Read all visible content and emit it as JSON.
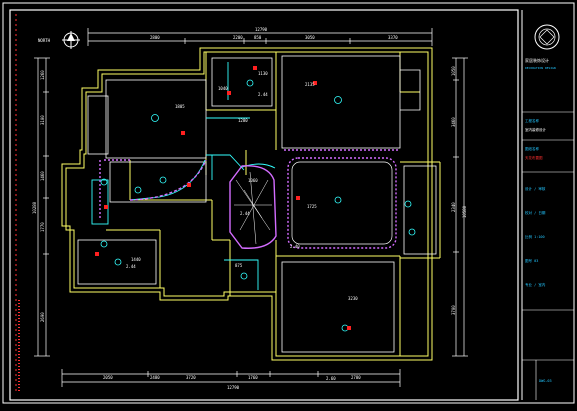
{
  "colors": {
    "background": "#000000",
    "frame": "#ffffff",
    "dimension": "#ffffff",
    "wall": "#ffff66",
    "ceiling_outline": "#ffffff",
    "cyan_line": "#33ffff",
    "magenta_line": "#d36cff",
    "marker": "#ff2020",
    "titleblock_text": "#22c6ff",
    "titleblock_red": "#ff3030"
  },
  "north_label": "NORTH",
  "dims_top": {
    "total": "12790",
    "seg1": "2800",
    "seg2": "2200",
    "seg3": "850",
    "seg4": "3050",
    "seg5": "3370"
  },
  "dims_bottom": {
    "total": "12790",
    "seg1": "2050",
    "seg2": "2480",
    "seg3": "3720",
    "seg4": "1760",
    "seg5": "2780"
  },
  "dims_left": {
    "total": "10280",
    "seg1": "1260",
    "seg2": "3100",
    "seg3": "1460",
    "seg4": "1770",
    "seg5": "2690"
  },
  "dims_right": {
    "total": "10580",
    "seg1": "1050",
    "seg2": "3460",
    "seg3": "2340",
    "seg4": "3700"
  },
  "room_labels": {
    "r1": "1805",
    "r2": "2135",
    "r3": "1280",
    "r4": "1725",
    "r5": "1440",
    "r6": "3230",
    "r7": "1130",
    "r8": "1040",
    "r9": "875",
    "r10": "1060",
    "lvl1": "2.44",
    "lvl2": "2.44",
    "lvl3": "2.40",
    "lvl4": "2.44",
    "lvl5": "2.60"
  },
  "titleblock": {
    "company": "家居装饰设计",
    "company_en": "DECORATION DESIGN",
    "project_label": "工程名称",
    "project_value": "室内装修设计",
    "drawing_label": "图纸名称",
    "drawing_value": "天花布置图",
    "rows": [
      "设计 / 审核",
      "校对 / 日期",
      "比例 1:100",
      "图号 03",
      "专业 / 室内"
    ],
    "footer": "DWG-03"
  }
}
